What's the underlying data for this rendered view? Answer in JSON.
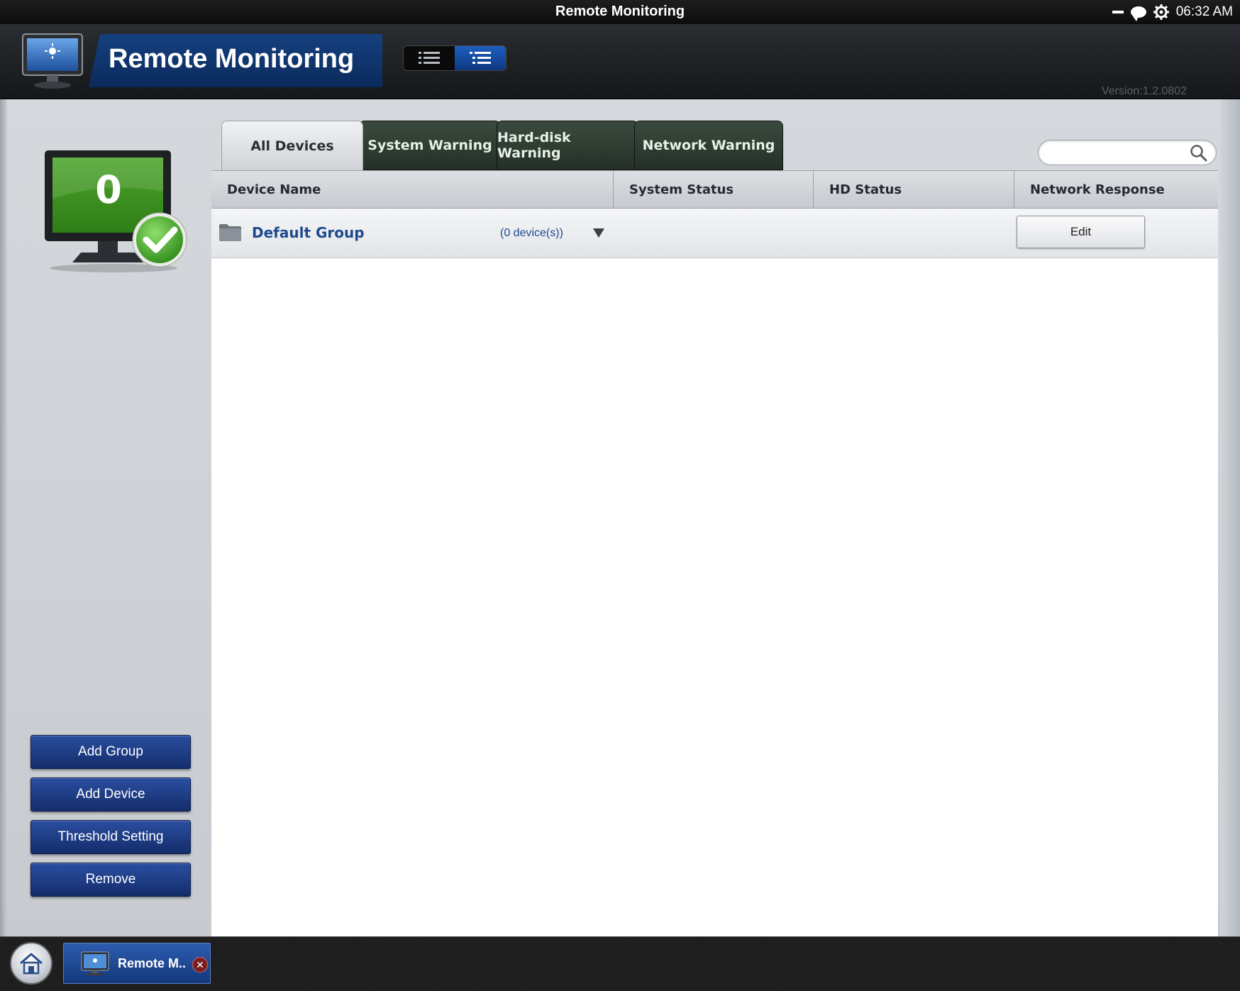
{
  "os_bar": {
    "title": "Remote Monitoring",
    "time": "06:32 AM"
  },
  "header": {
    "title": "Remote Monitoring",
    "version": "Version:1.2.0802",
    "view_modes": [
      "list-view-icon",
      "tree-view-icon"
    ],
    "active_view": "tree-view-icon"
  },
  "status": {
    "device_count": "0",
    "state": "ok"
  },
  "tabs": [
    {
      "label": "All Devices",
      "active": true
    },
    {
      "label": "System Warning",
      "active": false
    },
    {
      "label": "Hard-disk Warning",
      "active": false
    },
    {
      "label": "Network Warning",
      "active": false
    }
  ],
  "search": {
    "value": "",
    "placeholder": ""
  },
  "table": {
    "columns": [
      "Device Name",
      "System Status",
      "HD Status",
      "Network Response"
    ],
    "groups": [
      {
        "name": "Default Group",
        "count": "(0 device(s))",
        "action_label": "Edit"
      }
    ]
  },
  "sidebar": {
    "buttons": [
      "Add Group",
      "Add Device",
      "Threshold Setting",
      "Remove"
    ]
  },
  "taskbar": {
    "items": [
      {
        "label": "Remote M..",
        "active": true
      }
    ]
  },
  "colors": {
    "accent_blue": "#14387a",
    "header_dark": "#15171a",
    "tab_inactive": "#2e3b31",
    "status_green": "#4aa32a"
  }
}
